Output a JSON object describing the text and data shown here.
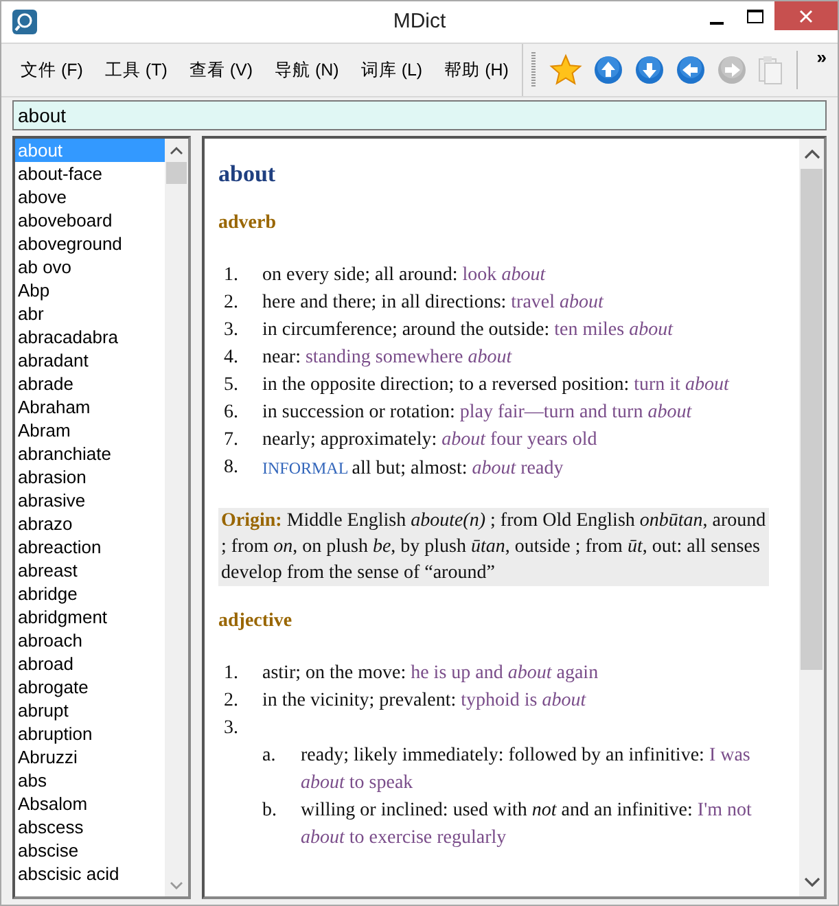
{
  "window": {
    "title": "MDict"
  },
  "menu": [
    {
      "label": "文件 (F)"
    },
    {
      "label": "工具 (T)"
    },
    {
      "label": "查看 (V)"
    },
    {
      "label": "导航 (N)"
    },
    {
      "label": "词库 (L)"
    },
    {
      "label": "帮助 (H)"
    }
  ],
  "toolbar": [
    {
      "kind": "star",
      "disabled": false
    },
    {
      "kind": "up",
      "disabled": false
    },
    {
      "kind": "down",
      "disabled": false
    },
    {
      "kind": "back",
      "disabled": false
    },
    {
      "kind": "forward",
      "disabled": true
    },
    {
      "kind": "clipboard",
      "disabled": true
    }
  ],
  "toolbar_overflow": "»",
  "search": {
    "value": "about"
  },
  "word_list": [
    {
      "word": "about",
      "selected": true
    },
    {
      "word": "about-face",
      "selected": false
    },
    {
      "word": "above",
      "selected": false
    },
    {
      "word": "aboveboard",
      "selected": false
    },
    {
      "word": "aboveground",
      "selected": false
    },
    {
      "word": "ab ovo",
      "selected": false
    },
    {
      "word": "Abp",
      "selected": false
    },
    {
      "word": "abr",
      "selected": false
    },
    {
      "word": "abracadabra",
      "selected": false
    },
    {
      "word": "abradant",
      "selected": false
    },
    {
      "word": "abrade",
      "selected": false
    },
    {
      "word": "Abraham",
      "selected": false
    },
    {
      "word": "Abram",
      "selected": false
    },
    {
      "word": "abranchiate",
      "selected": false
    },
    {
      "word": "abrasion",
      "selected": false
    },
    {
      "word": "abrasive",
      "selected": false
    },
    {
      "word": "abrazo",
      "selected": false
    },
    {
      "word": "abreaction",
      "selected": false
    },
    {
      "word": "abreast",
      "selected": false
    },
    {
      "word": "abridge",
      "selected": false
    },
    {
      "word": "abridgment",
      "selected": false
    },
    {
      "word": "abroach",
      "selected": false
    },
    {
      "word": "abroad",
      "selected": false
    },
    {
      "word": "abrogate",
      "selected": false
    },
    {
      "word": "abrupt",
      "selected": false
    },
    {
      "word": "abruption",
      "selected": false
    },
    {
      "word": "Abruzzi",
      "selected": false
    },
    {
      "word": "abs",
      "selected": false
    },
    {
      "word": "Absalom",
      "selected": false
    },
    {
      "word": "abscess",
      "selected": false
    },
    {
      "word": "abscise",
      "selected": false
    },
    {
      "word": "abscisic acid",
      "selected": false
    }
  ],
  "entry": {
    "headword": "about",
    "sections": [
      {
        "kind": "pos",
        "label": "adverb",
        "senses": [
          {
            "number": "1.",
            "text": "on every side; all around:",
            "example": "look *about*"
          },
          {
            "number": "2.",
            "text": "here and there; in all directions:",
            "example": "travel *about*"
          },
          {
            "number": "3.",
            "text": "in circumference; around the outside:",
            "example": "ten miles *about*"
          },
          {
            "number": "4.",
            "text": "near:",
            "example": "standing somewhere *about*"
          },
          {
            "number": "5.",
            "text": "in the opposite direction; to a reversed position:",
            "example": "turn it *about*"
          },
          {
            "number": "6.",
            "text": "in succession or rotation:",
            "example": "play fair—turn and turn *about*"
          },
          {
            "number": "7.",
            "text": "nearly; approximately:",
            "example": "*about* four years old"
          },
          {
            "number": "8.",
            "register": "INFORMAL",
            "text": "all but; almost:",
            "example": "*about* ready"
          }
        ]
      },
      {
        "kind": "origin",
        "label": "Origin:",
        "text": "Middle English *aboute(n)* ; from Old English *onbūtan*, around ; from *on*, on plush *be*, by plush *ūtan*, outside ; from *ūt*, out: all senses develop from the sense of “around”"
      },
      {
        "kind": "pos",
        "label": "adjective",
        "senses": [
          {
            "number": "1.",
            "text": "astir; on the move:",
            "example": "he is up and *about* again"
          },
          {
            "number": "2.",
            "text": "in the vicinity; prevalent:",
            "example": "typhoid is *about*"
          },
          {
            "number": "3.",
            "subsenses": [
              {
                "number": "a.",
                "text": "ready; likely immediately: followed by an infinitive:",
                "example": "I was *about* to speak"
              },
              {
                "number": "b.",
                "text": "willing or inclined: used with *not* and an infinitive:",
                "example": "I'm not *about* to exercise regularly"
              }
            ]
          }
        ]
      }
    ]
  }
}
